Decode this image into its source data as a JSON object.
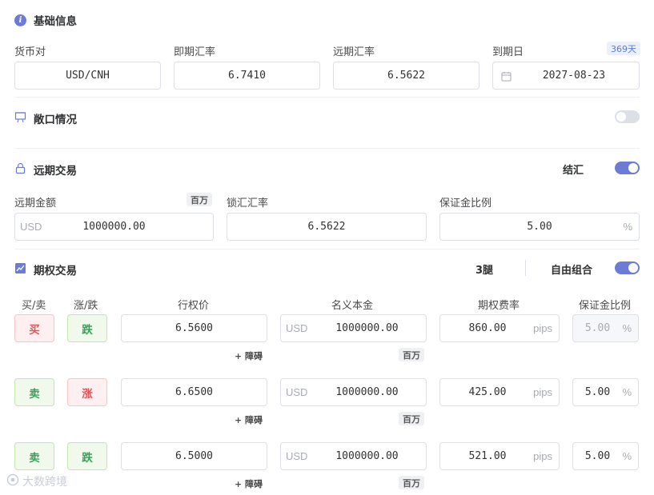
{
  "basic": {
    "title": "基础信息",
    "pair_label": "货币对",
    "pair_value": "USD/CNH",
    "spot_label": "即期汇率",
    "spot_value": "6.7410",
    "forward_label": "远期汇率",
    "forward_value": "6.5622",
    "expiry_label": "到期日",
    "expiry_days": "369天",
    "expiry_value": "2027-08-23"
  },
  "exposure": {
    "title": "敞口情况",
    "toggle_on": false
  },
  "forward_trade": {
    "title": "远期交易",
    "direction_label": "结汇",
    "toggle_on": true,
    "amount_label": "远期金额",
    "amount_unit_badge": "百万",
    "amount_currency": "USD",
    "amount_value": "1000000.00",
    "locked_rate_label": "锁汇汇率",
    "locked_rate_value": "6.5622",
    "margin_label": "保证金比例",
    "margin_value": "5.00",
    "margin_unit": "%"
  },
  "option_trade": {
    "title": "期权交易",
    "legs_count": "3腿",
    "combo_label": "自由组合",
    "toggle_on": true,
    "headers": {
      "buy_sell": "买/卖",
      "up_down": "涨/跌",
      "strike": "行权价",
      "notional": "名义本金",
      "premium": "期权费率",
      "margin": "保证金比例"
    },
    "legs": [
      {
        "side": "买",
        "side_color": "red",
        "dir": "跌",
        "dir_color": "green",
        "strike": "6.5600",
        "barrier": "+ 障碍",
        "currency": "USD",
        "notional": "1000000.00",
        "unit_badge": "百万",
        "premium": "860.00",
        "premium_unit": "pips",
        "margin": "5.00",
        "margin_unit": "%",
        "margin_disabled": true
      },
      {
        "side": "卖",
        "side_color": "green",
        "dir": "涨",
        "dir_color": "red",
        "strike": "6.6500",
        "barrier": "+ 障碍",
        "currency": "USD",
        "notional": "1000000.00",
        "unit_badge": "百万",
        "premium": "425.00",
        "premium_unit": "pips",
        "margin": "5.00",
        "margin_unit": "%",
        "margin_disabled": false
      },
      {
        "side": "卖",
        "side_color": "green",
        "dir": "跌",
        "dir_color": "green",
        "strike": "6.5000",
        "barrier": "+ 障碍",
        "currency": "USD",
        "notional": "1000000.00",
        "unit_badge": "百万",
        "premium": "521.00",
        "premium_unit": "pips",
        "margin": "5.00",
        "margin_unit": "%",
        "margin_disabled": false
      }
    ]
  },
  "watermark": "大数跨境",
  "colors": {
    "accent": "#6b7bd6",
    "red": "#e0555a",
    "green": "#3aa15c"
  }
}
